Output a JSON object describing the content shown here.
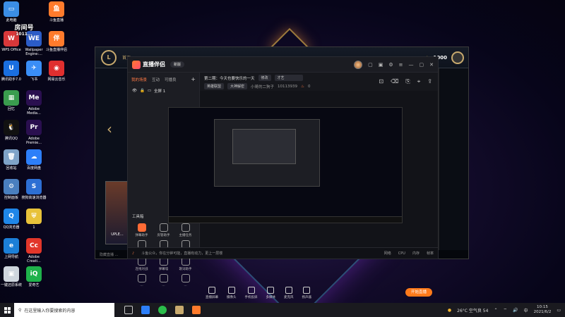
{
  "desktop": {
    "icons": [
      {
        "label": "此电脑",
        "color": "#3b8ee5",
        "glyph": "▭"
      },
      {
        "label": "斗鱼直播",
        "color": "#ff7b2c",
        "glyph": "鱼"
      },
      {
        "label": "WPS Office",
        "color": "#d9383a",
        "glyph": "W"
      },
      {
        "label": "Wallpaper Engine:...",
        "color": "#2b5cc7",
        "glyph": "WE"
      },
      {
        "label": "斗鱼直播伴侣",
        "color": "#ff7b2c",
        "glyph": "伴"
      },
      {
        "label": "腾讯助手7.0",
        "color": "#1a6fe0",
        "glyph": "U"
      },
      {
        "label": "飞书",
        "color": "#3a8ef6",
        "glyph": "✈"
      },
      {
        "label": "网易云音乐",
        "color": "#e02f2f",
        "glyph": "◉"
      },
      {
        "label": "回忆",
        "color": "#3a9c4e",
        "glyph": "▦"
      },
      {
        "label": "Adobe Media...",
        "color": "#2a0f4f",
        "glyph": "Me"
      },
      {
        "label": "腾讯QQ",
        "color": "#111111",
        "glyph": "🐧"
      },
      {
        "label": "Adobe Premie...",
        "color": "#2a0f4f",
        "glyph": "Pr"
      },
      {
        "label": "回收站",
        "color": "#7fa3c8",
        "glyph": "🗑"
      },
      {
        "label": "百度网盘",
        "color": "#2d7ff9",
        "glyph": "☁"
      },
      {
        "label": "控制面板",
        "color": "#4a7fbf",
        "glyph": "⚙"
      },
      {
        "label": "搜狗高速浏览器",
        "color": "#2d6fd4",
        "glyph": "S"
      },
      {
        "label": "QQ浏览器",
        "color": "#1f86e8",
        "glyph": "Q"
      },
      {
        "label": "1",
        "color": "#e8c23a",
        "glyph": "⛨"
      },
      {
        "label": "上网导航",
        "color": "#1c7fd8",
        "glyph": "e"
      },
      {
        "label": "Adobe Creati...",
        "color": "#e2362a",
        "glyph": "Cc"
      },
      {
        "label": "一键还原系统",
        "color": "#cfd6de",
        "glyph": "▣"
      },
      {
        "label": "爱奇艺",
        "color": "#1fb24b",
        "glyph": "iQ"
      }
    ],
    "overlay_text": "房间号",
    "overlay_sub": "1011..."
  },
  "lol": {
    "logo": "L",
    "coins": "1000",
    "left_label": "首页",
    "bottom_text": "隐藏直播 ...",
    "card_text": "UPLE..."
  },
  "app": {
    "name": "直播伴侣",
    "version": "新版",
    "left_tabs": [
      "我的场景",
      "互动",
      "可播良",
      "+"
    ],
    "scene_label": "全屏 1",
    "title": "第二期：今天也要快乐的一天",
    "edit_btn": "修改",
    "category": "才艺",
    "tags": [
      "英雄联盟",
      "大神解密"
    ],
    "streamer": "小哥的二狗子",
    "room_id": "10113939",
    "fire_count": "0",
    "tools_header": "工具箱",
    "tools": [
      {
        "label": "弹幕助手",
        "hot": true
      },
      {
        "label": "房管助手",
        "hot": false
      },
      {
        "label": "主播任务",
        "hot": false
      },
      {
        "label": "视频连麦",
        "hot": false
      },
      {
        "label": "录入连接",
        "hot": false
      },
      {
        "label": "摄录器",
        "hot": false
      },
      {
        "label": "连线对战",
        "hot": false
      },
      {
        "label": "弹幕墙",
        "hot": false
      },
      {
        "label": "歌词助手",
        "hot": false
      },
      {
        "label": "...",
        "hot": false
      },
      {
        "label": "...",
        "hot": false
      },
      {
        "label": "...",
        "hot": false
      }
    ],
    "bottom_tools": [
      "直播屏幕",
      "摄像头",
      "手机投屏",
      "多媒体",
      "麦克风",
      "扬声器"
    ],
    "start_live": "开始直播",
    "status_text": "斗鱼公众，你在分钟可能，直播有动力，更上一层楼",
    "status_right": [
      "网络",
      "CPU",
      "内存",
      "帧率"
    ]
  },
  "taskbar": {
    "search_placeholder": "在这里输入你要搜索的内容",
    "weather": "26°C 空气良 54",
    "time": "10:15",
    "date": "2021/6/2"
  }
}
